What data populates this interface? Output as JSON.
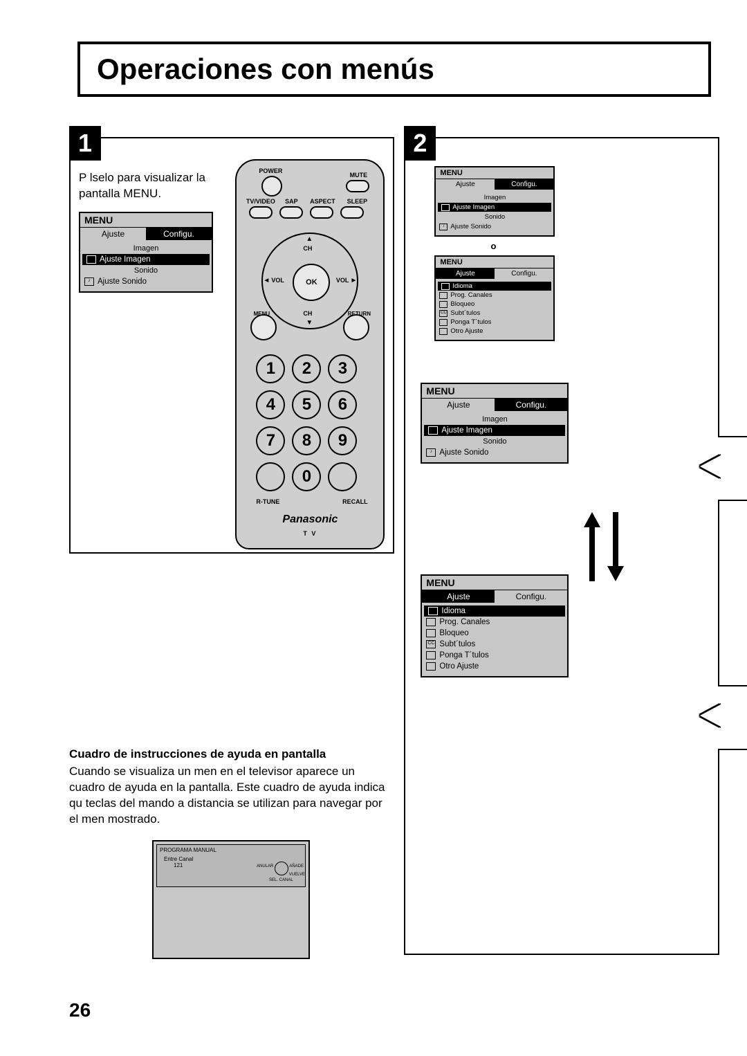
{
  "page": {
    "title": "Operaciones con menús",
    "number": "26"
  },
  "step1": {
    "number": "1",
    "text": "P lselo para visualizar la pantalla MENU."
  },
  "step2": {
    "number": "2",
    "or_label": "o"
  },
  "menu_ajuste": {
    "header": "MENU",
    "tabs": {
      "left": "Ajuste",
      "right": "Configu."
    },
    "section1": "Imagen",
    "row1": "Ajuste Imagen",
    "section2": "Sonido",
    "row2": "Ajuste Sonido"
  },
  "menu_configu": {
    "header": "MENU",
    "tabs": {
      "left": "Ajuste",
      "right": "Configu."
    },
    "rows": [
      "Idioma",
      "Prog. Canales",
      "Bloqueo",
      "Subt´tulos",
      "Ponga T´tulos",
      "Otro Ajuste"
    ]
  },
  "remote": {
    "power": "POWER",
    "mute": "MUTE",
    "row_labels": [
      "TV/VIDEO",
      "SAP",
      "ASPECT",
      "SLEEP"
    ],
    "vol": "VOL",
    "ch": "CH",
    "ok": "OK",
    "menu": "MENU",
    "return": "RETURN",
    "numbers": [
      "1",
      "2",
      "3",
      "4",
      "5",
      "6",
      "7",
      "8",
      "9",
      "",
      "0",
      ""
    ],
    "rtune": "R-TUNE",
    "recall": "RECALL",
    "brand": "Panasonic",
    "tv_label": "T V"
  },
  "help": {
    "heading": "Cuadro de instrucciones de ayuda en pantalla",
    "body": "Cuando se visualiza un men en el televisor aparece un cuadro de ayuda en la pantalla. Este cuadro de ayuda indica qu teclas del mando a distancia se utilizan para navegar por el men mostrado.",
    "tv_title": "PROGRAMA MANUAL",
    "tv_line1": "Entre Canal",
    "tv_line2": "121",
    "tv_anular": "ANULAR",
    "tv_anade": "AÑADE",
    "tv_vuelve": "VUELVE",
    "tv_sel": "SEL. CANAL"
  }
}
